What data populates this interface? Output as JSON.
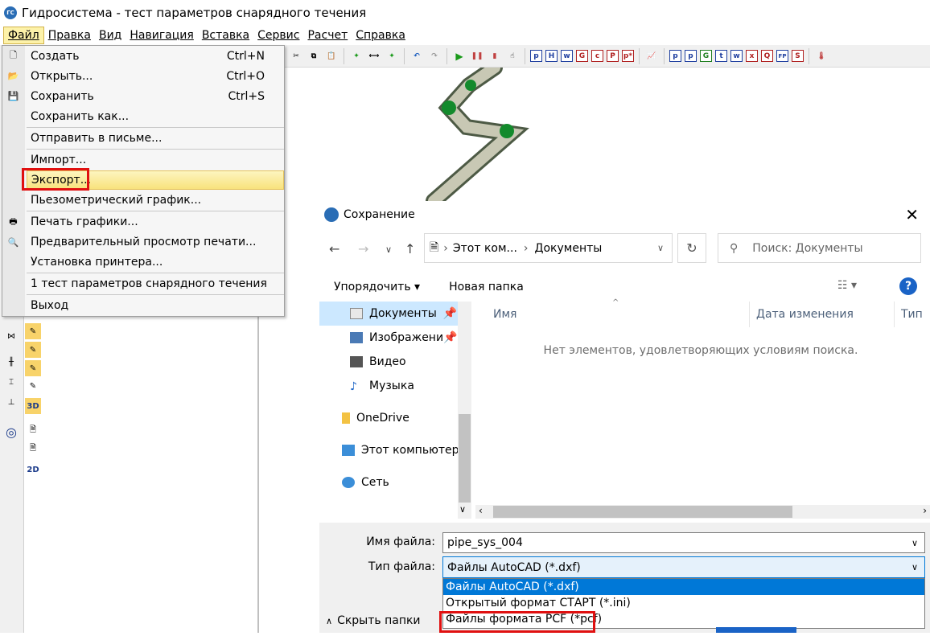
{
  "app": {
    "title": "Гидросистема - тест параметров снарядного течения",
    "icon_text": "ГС"
  },
  "menubar": [
    "Файл",
    "Правка",
    "Вид",
    "Навигация",
    "Вставка",
    "Сервис",
    "Расчет",
    "Справка"
  ],
  "file_menu": {
    "items": [
      {
        "label": "Создать",
        "shortcut": "Ctrl+N"
      },
      {
        "label": "Открыть...",
        "shortcut": "Ctrl+O"
      },
      {
        "label": "Сохранить",
        "shortcut": "Ctrl+S"
      },
      {
        "label": "Сохранить как..."
      },
      {
        "label": "Отправить в письме..."
      },
      {
        "label": "Импорт..."
      },
      {
        "label": "Экспорт..."
      },
      {
        "label": "Пьезометрический график..."
      },
      {
        "label": "Печать графики..."
      },
      {
        "label": "Предварительный просмотр печати..."
      },
      {
        "label": "Установка принтера..."
      },
      {
        "label": "1 тест параметров снарядного течения"
      },
      {
        "label": "Выход"
      }
    ]
  },
  "toolbar_letters": [
    "p",
    "H",
    "w",
    "G",
    "c",
    "P",
    "p*",
    "p",
    "p",
    "G",
    "t",
    "w",
    "x",
    "Q",
    "FP",
    "S"
  ],
  "left_icons": {
    "three_d": "3D",
    "two_d": "2D"
  },
  "dialog": {
    "title": "Сохранение",
    "breadcrumb": [
      "Этот ком...",
      "Документы"
    ],
    "search_placeholder": "Поиск: Документы",
    "organize": "Упорядочить",
    "new_folder": "Новая папка",
    "help": "?",
    "nav_items": [
      "Документы",
      "Изображени",
      "Видео",
      "Музыка",
      "OneDrive",
      "Этот компьютер",
      "Сеть"
    ],
    "columns": [
      "Имя",
      "Дата изменения",
      "Тип"
    ],
    "empty_text": "Нет элементов, удовлетворяющих условиям поиска.",
    "filename_label": "Имя файла:",
    "filename_value": "pipe_sys_004",
    "filetype_label": "Тип файла:",
    "filetype_value": "Файлы AutoCAD (*.dxf)",
    "filetype_options": [
      "Файлы AutoCAD (*.dxf)",
      "Открытый формат СТАРТ (*.ini)",
      "Файлы формата PCF (*pcf)"
    ],
    "hide_folders": "Скрыть папки"
  }
}
